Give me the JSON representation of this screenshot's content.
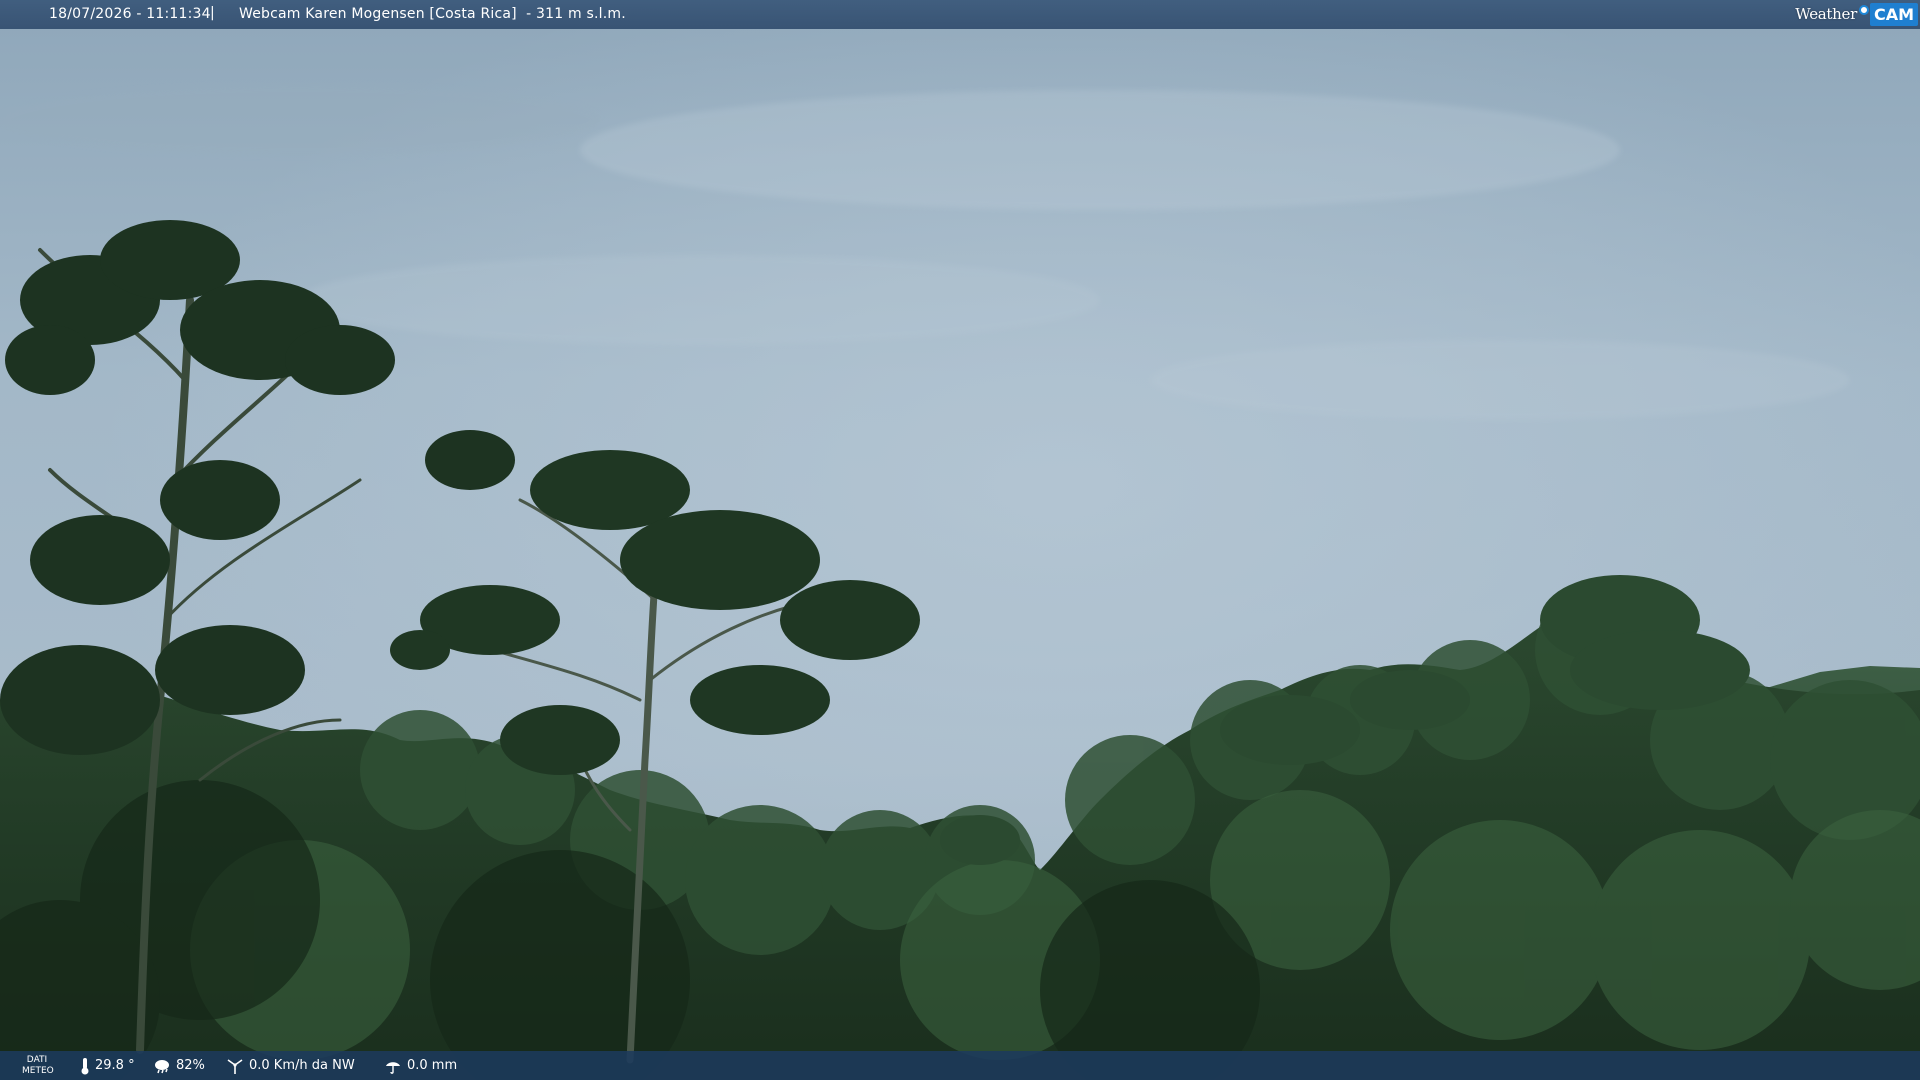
{
  "header": {
    "timestamp": "18/07/2026 - 11:11:34",
    "separator": "|",
    "title": "Webcam Karen Mogensen [Costa Rica]  - 311 m s.l.m."
  },
  "logo": {
    "weather": "Weather",
    "cam": "CAM"
  },
  "footer": {
    "label_line1": "DATI",
    "label_line2": "METEO",
    "temperature": "29.8 °",
    "humidity": "82%",
    "wind": "0.0 Km/h da NW",
    "rain": "0.0 mm"
  },
  "colors": {
    "sky": "#9fb6c7",
    "foliage_dark": "#1c3220",
    "bar": "#2c486a",
    "logo_accent": "#1f7fd0"
  },
  "icons": [
    "thermometer-icon",
    "humidity-icon",
    "wind-icon",
    "rain-icon"
  ]
}
